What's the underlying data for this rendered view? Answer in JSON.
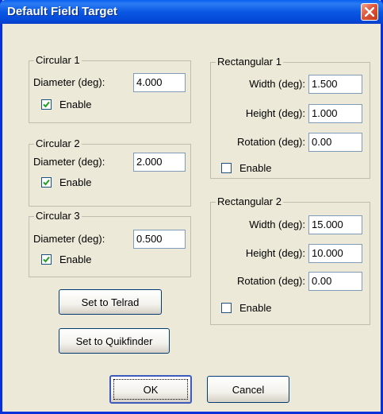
{
  "window": {
    "title": "Default Field Target"
  },
  "circular": [
    {
      "group_label": "Circular 1",
      "diameter_label": "Diameter (deg):",
      "diameter_value": "4.000",
      "enable_label": "Enable",
      "enabled": true
    },
    {
      "group_label": "Circular 2",
      "diameter_label": "Diameter (deg):",
      "diameter_value": "2.000",
      "enable_label": "Enable",
      "enabled": true
    },
    {
      "group_label": "Circular 3",
      "diameter_label": "Diameter (deg):",
      "diameter_value": "0.500",
      "enable_label": "Enable",
      "enabled": true
    }
  ],
  "rectangular": [
    {
      "group_label": "Rectangular 1",
      "width_label": "Width (deg):",
      "width_value": "1.500",
      "height_label": "Height (deg):",
      "height_value": "1.000",
      "rotation_label": "Rotation (deg):",
      "rotation_value": "0.00",
      "enable_label": "Enable",
      "enabled": false
    },
    {
      "group_label": "Rectangular 2",
      "width_label": "Width (deg):",
      "width_value": "15.000",
      "height_label": "Height (deg):",
      "height_value": "10.000",
      "rotation_label": "Rotation (deg):",
      "rotation_value": "0.00",
      "enable_label": "Enable",
      "enabled": false
    }
  ],
  "buttons": {
    "set_telrad": "Set to Telrad",
    "set_quikfinder": "Set to Quikfinder",
    "ok": "OK",
    "cancel": "Cancel"
  },
  "colors": {
    "title_bar": "#0a58e4",
    "face": "#ece9d8",
    "close": "#e0563a"
  }
}
